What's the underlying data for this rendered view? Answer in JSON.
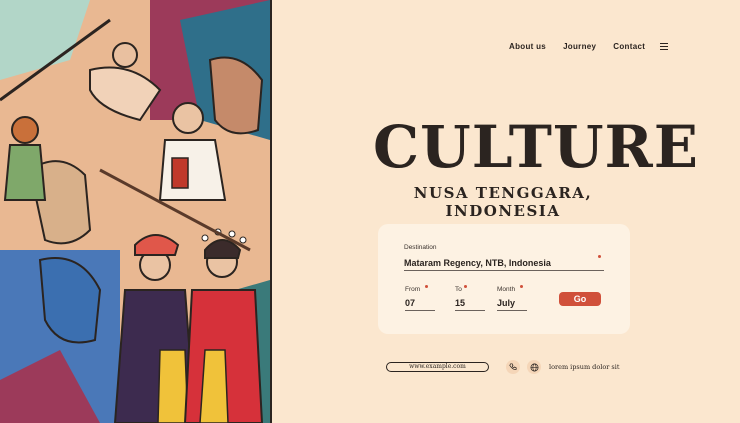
{
  "nav": {
    "items": [
      {
        "label": "About us"
      },
      {
        "label": "Journey"
      },
      {
        "label": "Contact"
      }
    ],
    "menu_icon": "hamburger-icon"
  },
  "hero": {
    "title": "CULTURE",
    "subtitle": "NUSA TENGGARA, INDONESIA"
  },
  "booking": {
    "destination_label": "Destination",
    "destination_value": "Mataram Regency, NTB, Indonesia",
    "from_label": "From",
    "from_value": "07",
    "to_label": "To",
    "to_value": "15",
    "month_label": "Month",
    "month_value": "July",
    "go_label": "Go"
  },
  "footer": {
    "url": "www.example.com",
    "text": "lorem ipsum dolor sit",
    "icons": [
      "phone-icon",
      "globe-icon"
    ]
  },
  "colors": {
    "background": "#fbe7cf",
    "card": "#fdf2e3",
    "accent": "#d0503a",
    "ink": "#2b2420"
  }
}
